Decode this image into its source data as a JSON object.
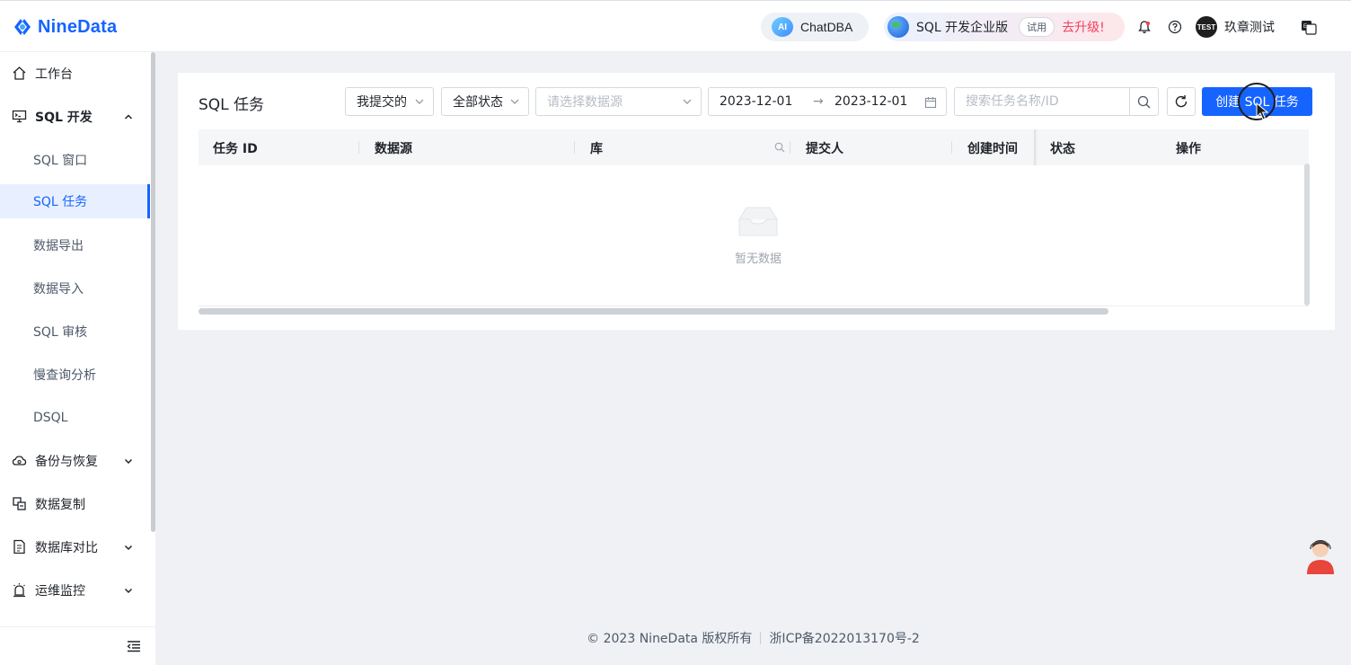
{
  "brand": {
    "name": "NineData"
  },
  "header": {
    "chatdba_icon_text": "AI",
    "chatdba_label": "ChatDBA",
    "edition_label": "SQL 开发企业版",
    "trial_badge": "试用",
    "upgrade_label": "去升级!",
    "user_avatar_text": "TEST",
    "user_name": "玖章测试",
    "icons": [
      "bell-icon",
      "help-icon",
      "language-icon"
    ]
  },
  "sidebar": {
    "items": [
      {
        "label": "工作台",
        "icon": "home-icon"
      },
      {
        "label": "SQL 开发",
        "icon": "monitor-icon",
        "expanded": true
      },
      {
        "label": "SQL 窗口"
      },
      {
        "label": "SQL 任务",
        "active": true
      },
      {
        "label": "数据导出"
      },
      {
        "label": "数据导入"
      },
      {
        "label": "SQL 审核"
      },
      {
        "label": "慢查询分析"
      },
      {
        "label": "DSQL"
      },
      {
        "label": "备份与恢复",
        "icon": "cloud-icon"
      },
      {
        "label": "数据复制",
        "icon": "copy-icon"
      },
      {
        "label": "数据库对比",
        "icon": "compare-icon"
      },
      {
        "label": "运维监控",
        "icon": "alarm-icon"
      }
    ]
  },
  "main": {
    "title": "SQL 任务",
    "filters": {
      "submitter": "我提交的",
      "status": "全部状态",
      "datasource_placeholder": "请选择数据源",
      "date_start": "2023-12-01",
      "date_sep": "→",
      "date_end": "2023-12-01",
      "search_placeholder": "搜索任务名称/ID"
    },
    "create_button": "创建 SQL 任务",
    "table": {
      "columns": [
        "任务 ID",
        "数据源",
        "库",
        "提交人",
        "创建时间",
        "状态",
        "操作"
      ],
      "rows": [],
      "empty_text": "暂无数据"
    }
  },
  "footer": {
    "copyright": "© 2023 NineData 版权所有",
    "icp": "浙ICP备2022013170号-2"
  },
  "colors": {
    "primary": "#1664ff",
    "upgrade": "#f53f5b"
  }
}
